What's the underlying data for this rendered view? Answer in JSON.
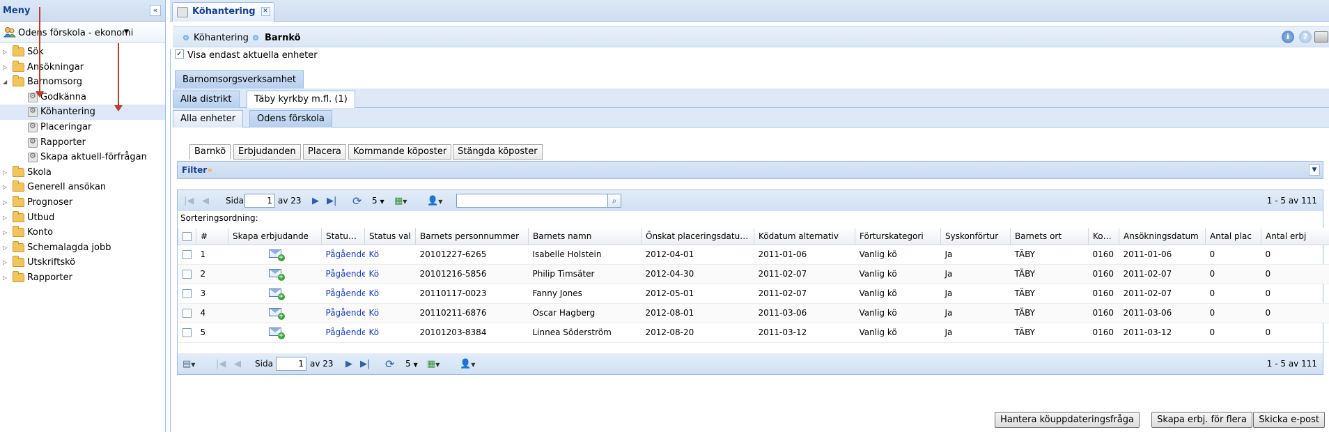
{
  "sidebar": {
    "title": "Meny",
    "org_label": "Odens förskola - ekonomi",
    "tree": [
      {
        "label": "Sök",
        "type": "folder",
        "expanded": false
      },
      {
        "label": "Ansökningar",
        "type": "folder",
        "expanded": false
      },
      {
        "label": "Barnomsorg",
        "type": "folder",
        "expanded": true
      },
      {
        "label": "Godkänna",
        "type": "leaf"
      },
      {
        "label": "Köhantering",
        "type": "leaf",
        "selected": true
      },
      {
        "label": "Placeringar",
        "type": "leaf"
      },
      {
        "label": "Rapporter",
        "type": "leaf"
      },
      {
        "label": "Skapa aktuell-förfrågan",
        "type": "leaf"
      },
      {
        "label": "Skola",
        "type": "folder",
        "expanded": false
      },
      {
        "label": "Generell ansökan",
        "type": "folder",
        "expanded": false
      },
      {
        "label": "Prognoser",
        "type": "folder",
        "expanded": false
      },
      {
        "label": "Utbud",
        "type": "folder",
        "expanded": false
      },
      {
        "label": "Konto",
        "type": "folder",
        "expanded": false
      },
      {
        "label": "Schemalagda jobb",
        "type": "folder",
        "expanded": false
      },
      {
        "label": "Utskriftskö",
        "type": "folder",
        "expanded": false
      },
      {
        "label": "Rapporter",
        "type": "folder",
        "expanded": false
      }
    ]
  },
  "main_tab": {
    "label": "Köhantering"
  },
  "breadcrumb": {
    "item1": "Köhantering",
    "item2": "Barnkö"
  },
  "header_icons": [
    "info-icon",
    "help-icon",
    "print-icon"
  ],
  "filters": {
    "only_current_units_label": "Visa endast aktuella enheter",
    "only_current_units_checked": true
  },
  "activity_tabs": [
    "Barnomsorgsverksamhet"
  ],
  "district_tabs": [
    "Alla distrikt",
    "Täby kyrkby m.fl.  (1)"
  ],
  "unit_tabs": [
    "Alla enheter",
    "Odens förskola"
  ],
  "sub_tabs": [
    "Barnkö",
    "Erbjudanden",
    "Placera",
    "Kommande köposter",
    "Stängda köposter"
  ],
  "filter_panel": {
    "label": "Filter"
  },
  "paging": {
    "page_label": "Sida",
    "page_value": "1",
    "of_label": "av 23",
    "page_size": "5",
    "summary": "1 - 5 av 111",
    "search_value": ""
  },
  "sort_label": "Sorteringsordning:",
  "grid": {
    "columns": [
      "#",
      "Skapa erbjudande",
      "Statu…",
      "Status val",
      "Barnets personnummer",
      "Barnets namn",
      "Önskat placeringsdatu…",
      "Ködatum alternativ",
      "Förturskategori",
      "Syskonförtur",
      "Barnets ort",
      "Ko…",
      "Ansökningsdatum",
      "Antal plac",
      "Antal erbj"
    ],
    "rows": [
      [
        "1",
        "",
        "Pågående",
        "Kö",
        "20101227-6265",
        "Isabelle Holstein",
        "2012-04-01",
        "2011-01-06",
        "Vanlig kö",
        "Ja",
        "TÄBY",
        "0160",
        "2011-01-06",
        "0",
        "0"
      ],
      [
        "2",
        "",
        "Pågående",
        "Kö",
        "20101216-5856",
        "Philip Timsäter",
        "2012-04-30",
        "2011-02-07",
        "Vanlig kö",
        "Ja",
        "TÄBY",
        "0160",
        "2011-02-07",
        "0",
        "0"
      ],
      [
        "3",
        "",
        "Pågående",
        "Kö",
        "20110117-0023",
        "Fanny Jones",
        "2012-05-01",
        "2011-02-07",
        "Vanlig kö",
        "Ja",
        "TÄBY",
        "0160",
        "2011-02-07",
        "0",
        "0"
      ],
      [
        "4",
        "",
        "Pågående",
        "Kö",
        "20110211-6876",
        "Oscar Hagberg",
        "2012-08-01",
        "2011-03-06",
        "Vanlig kö",
        "Ja",
        "TÄBY",
        "0160",
        "2011-03-06",
        "0",
        "0"
      ],
      [
        "5",
        "",
        "Pågående",
        "Kö",
        "20101203-8384",
        "Linnea Söderström",
        "2012-08-20",
        "2011-03-12",
        "Vanlig kö",
        "Ja",
        "TÄBY",
        "0160",
        "2011-03-12",
        "0",
        "0"
      ]
    ]
  },
  "footer_buttons": [
    "Hantera köuppdateringsfråga",
    "Skapa erbj. för flera",
    "Skicka e-post"
  ],
  "colors": {
    "link": "#1a3fbf",
    "panel_header": "#15428b",
    "annotation_arrow": "#c0392b"
  }
}
